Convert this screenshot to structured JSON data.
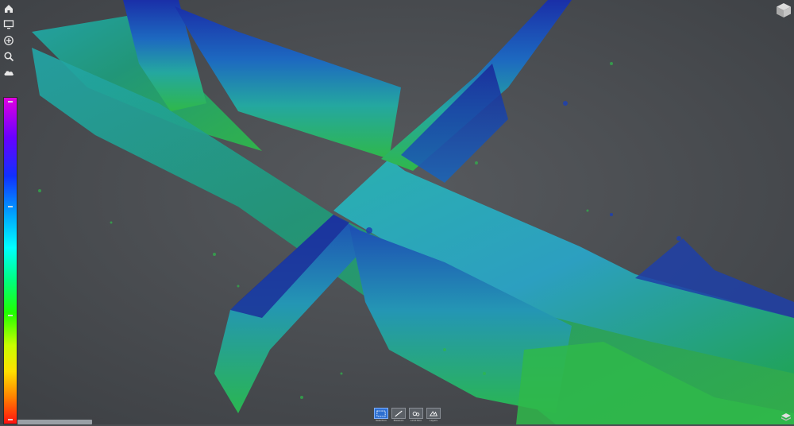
{
  "app": {
    "title": ""
  },
  "left_toolbar": {
    "items": [
      {
        "name": "home-icon"
      },
      {
        "name": "display-icon"
      },
      {
        "name": "add-icon"
      },
      {
        "name": "search-icon"
      },
      {
        "name": "cloud-icon"
      }
    ]
  },
  "colorbar": {
    "colors": [
      "#e000e0",
      "#6a00ff",
      "#1030ff",
      "#00a6ff",
      "#00ffff",
      "#00ff80",
      "#20ff00",
      "#c8ff00",
      "#ffe000",
      "#ff8000",
      "#ff1010"
    ]
  },
  "bottom_toolbar": {
    "buttons": [
      {
        "icon": "selection-icon",
        "label": "Selection",
        "active": true
      },
      {
        "icon": "measure-icon",
        "label": "Measure",
        "active": false
      },
      {
        "icon": "limit-box-icon",
        "label": "Limit Box",
        "active": false
      },
      {
        "icon": "layers-icon",
        "label": "Layers",
        "active": false
      }
    ]
  },
  "status": {
    "text": ""
  },
  "palette": {
    "background": "#4a4d51",
    "cloud_blue": "#1f3fa8",
    "cloud_cyan": "#2aa7b8",
    "cloud_green": "#2fb84a",
    "accent": "#2d6fd1"
  }
}
